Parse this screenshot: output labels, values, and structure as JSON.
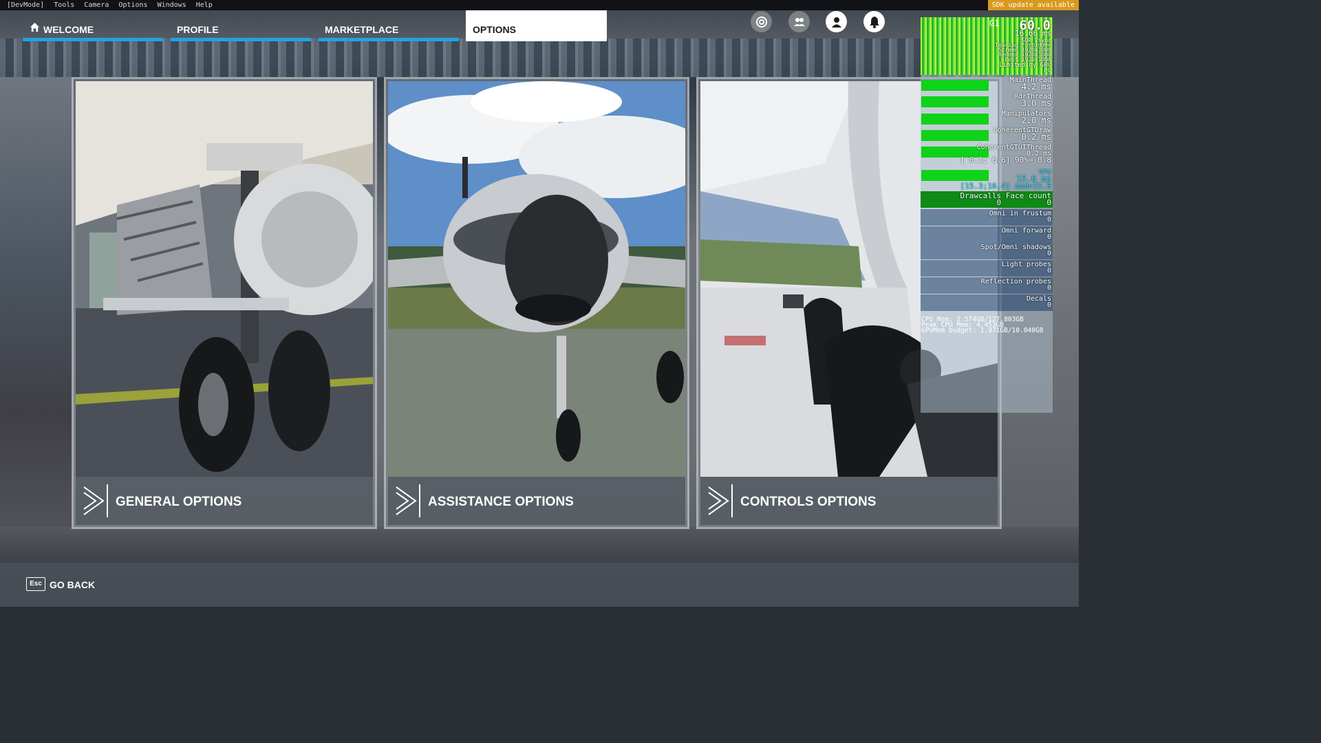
{
  "dev_menu": {
    "items": [
      "[DevMode]",
      "Tools",
      "Camera",
      "Options",
      "Windows",
      "Help"
    ],
    "sdk_notice": "SDK update available"
  },
  "nav": {
    "tabs": [
      {
        "label": "WELCOME",
        "icon": "home-icon",
        "active": false
      },
      {
        "label": "PROFILE",
        "active": false
      },
      {
        "label": "MARKETPLACE",
        "active": false
      },
      {
        "label": "OPTIONS",
        "active": true
      }
    ],
    "accent": "#21a3e6"
  },
  "top_icons": [
    "activity-icon",
    "friends-icon",
    "profile-icon",
    "notifications-icon"
  ],
  "cards": [
    {
      "title": "GENERAL OPTIONS",
      "image": "airliner-landing-gear"
    },
    {
      "title": "ASSISTANCE OPTIONS",
      "image": "propeller-aircraft-front"
    },
    {
      "title": "CONTROLS OPTIONS",
      "image": "cockpit-yoke"
    }
  ],
  "perf": {
    "fps": "60.0",
    "gpu_label": "G1",
    "frame_ms": "16.66 ms",
    "lines_top": [
      "SDR Vsync",
      "Tearing forbidden",
      "Screen 1920x1080",
      "Render 1920x1080",
      "Post 1920x1080",
      "Limited by GPU",
      "PC"
    ],
    "threads": [
      {
        "name": "MainThread",
        "value": "4.2 ms"
      },
      {
        "name": "RdrThread",
        "value": "3.0 ms"
      },
      {
        "name": "Manipulators",
        "value": "2.0 ms"
      },
      {
        "name": "CoherentGTDraw",
        "value": "0.2 ms"
      },
      {
        "name": "CoherentGTUIThread",
        "value": "0.2 ms"
      }
    ],
    "ui_range": "[ 0.1; 6.6] 90%= 0.8",
    "gpu": {
      "name": "GPU",
      "value": "15.6 ms",
      "range": "[15.3;16.4] med=15.8"
    },
    "drawcalls": {
      "label": "Drawcalls Face count",
      "values": "0          0"
    },
    "counters": [
      {
        "label": "Omni in frustum",
        "value": "0"
      },
      {
        "label": "Omni forward",
        "value": "0"
      },
      {
        "label": "Spot/Omni shadows",
        "value": "0"
      },
      {
        "label": "Light probes",
        "value": "0"
      },
      {
        "label": "Reflection probes",
        "value": "0"
      },
      {
        "label": "Decals",
        "value": "0"
      }
    ],
    "memory": [
      "CPU Mem: 2.574GB/127.803GB",
      "Peak CPU Mem: 4.453GB",
      "GPUMem budget: 1.971GB/10.040GB"
    ]
  },
  "footer": {
    "key": "Esc",
    "label": "GO BACK"
  }
}
